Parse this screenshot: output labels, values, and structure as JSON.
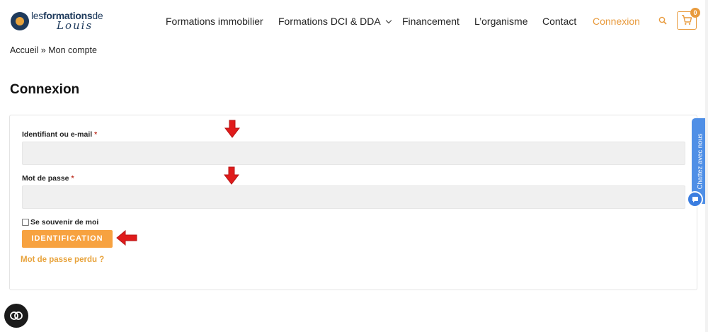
{
  "header": {
    "logo": {
      "brand_thin": "les",
      "brand_bold": "formations",
      "brand_suffix": "de",
      "script": "Louis"
    },
    "nav": [
      {
        "label": "Formations immobilier"
      },
      {
        "label": "Formations DCI & DDA"
      },
      {
        "label": "Financement"
      },
      {
        "label": "L’organisme"
      },
      {
        "label": "Contact"
      },
      {
        "label": "Connexion"
      }
    ],
    "search_icon": "search-icon",
    "cart": {
      "icon": "cart-icon",
      "count": "0"
    }
  },
  "breadcrumb": {
    "home": "Accueil",
    "separator": " » ",
    "current": "Mon compte"
  },
  "page": {
    "title": "Connexion"
  },
  "form": {
    "username_label": "Identifiant ou e-mail",
    "password_label": "Mot de passe",
    "required_mark": "*",
    "username_value": "",
    "password_value": "",
    "remember_label": "Se souvenir de moi",
    "remember_checked": false,
    "submit_label": "IDENTIFICATION",
    "lost_password": "Mot de passe perdu ?"
  },
  "chat": {
    "tab_label": "Chattez avec nous",
    "bubble_icon": "chat-icon"
  },
  "accessibility": {
    "icon": "accessibility-icon"
  },
  "colors": {
    "accent": "#e89a3c",
    "button": "#f7a240",
    "chat": "#4f8fe6",
    "annotation_arrow": "#e01b1b",
    "logo": "#1e3a5c"
  }
}
